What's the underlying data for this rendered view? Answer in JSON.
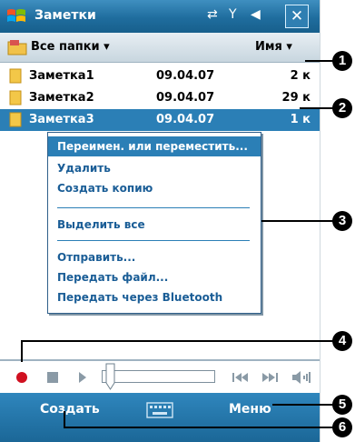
{
  "titlebar": {
    "title": "Заметки",
    "close_label": "✕",
    "status_icons": [
      "connectivity-icon",
      "signal-icon",
      "volume-icon"
    ]
  },
  "folderbar": {
    "folder_label": "Все папки ▾",
    "sort_label": "Имя ▾"
  },
  "files": [
    {
      "name": "Заметка1",
      "date": "09.04.07",
      "size": "2 к"
    },
    {
      "name": "Заметка2",
      "date": "09.04.07",
      "size": "29 к"
    },
    {
      "name": "Заметка3",
      "date": "09.04.07",
      "size": "1 к"
    }
  ],
  "context_menu": {
    "items": [
      "Переимен. или переместить...",
      "Удалить",
      "Создать копию",
      "Выделить все",
      "Отправить...",
      "Передать файл...",
      "Передать через Bluetooth"
    ]
  },
  "media_bar": {
    "progress": 0.0
  },
  "bottombar": {
    "left_soft": "Создать",
    "right_soft": "Меню"
  },
  "callouts": [
    "1",
    "2",
    "3",
    "4",
    "5",
    "6"
  ],
  "colors": {
    "accent": "#2b7fb6",
    "menu_text": "#1a5d96",
    "record": "#d01020"
  }
}
